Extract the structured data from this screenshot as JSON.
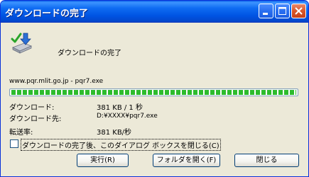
{
  "window": {
    "title": "ダウンロードの完了",
    "icons": {
      "app": "download-complete-icon",
      "minimize": "minimize-icon",
      "maximize": "maximize-icon",
      "close": "close-x-icon"
    },
    "colors": {
      "titlebar": "#0054e3",
      "face": "#ece9d8",
      "progress": "#2dbb2d"
    }
  },
  "heading": "ダウンロードの完了",
  "source": "www.pqr.mlit.go.jp - pqr7.exe",
  "progress": {
    "fraction": 1.0
  },
  "details": [
    {
      "label": "ダウンロード:",
      "value": "381 KB / 1 秒"
    },
    {
      "label": "ダウンロード先:",
      "value": "D:¥XXXX¥pqr7.exe"
    },
    {
      "label": "転送率:",
      "value": "381 KB/秒"
    }
  ],
  "checkbox": {
    "label": "ダウンロードの完了後、このダイアログ ボックスを閉じる(C)",
    "checked": false
  },
  "buttons": {
    "run": "実行(R)",
    "open_folder": "フォルダを開く(F)",
    "close": "閉じる"
  }
}
